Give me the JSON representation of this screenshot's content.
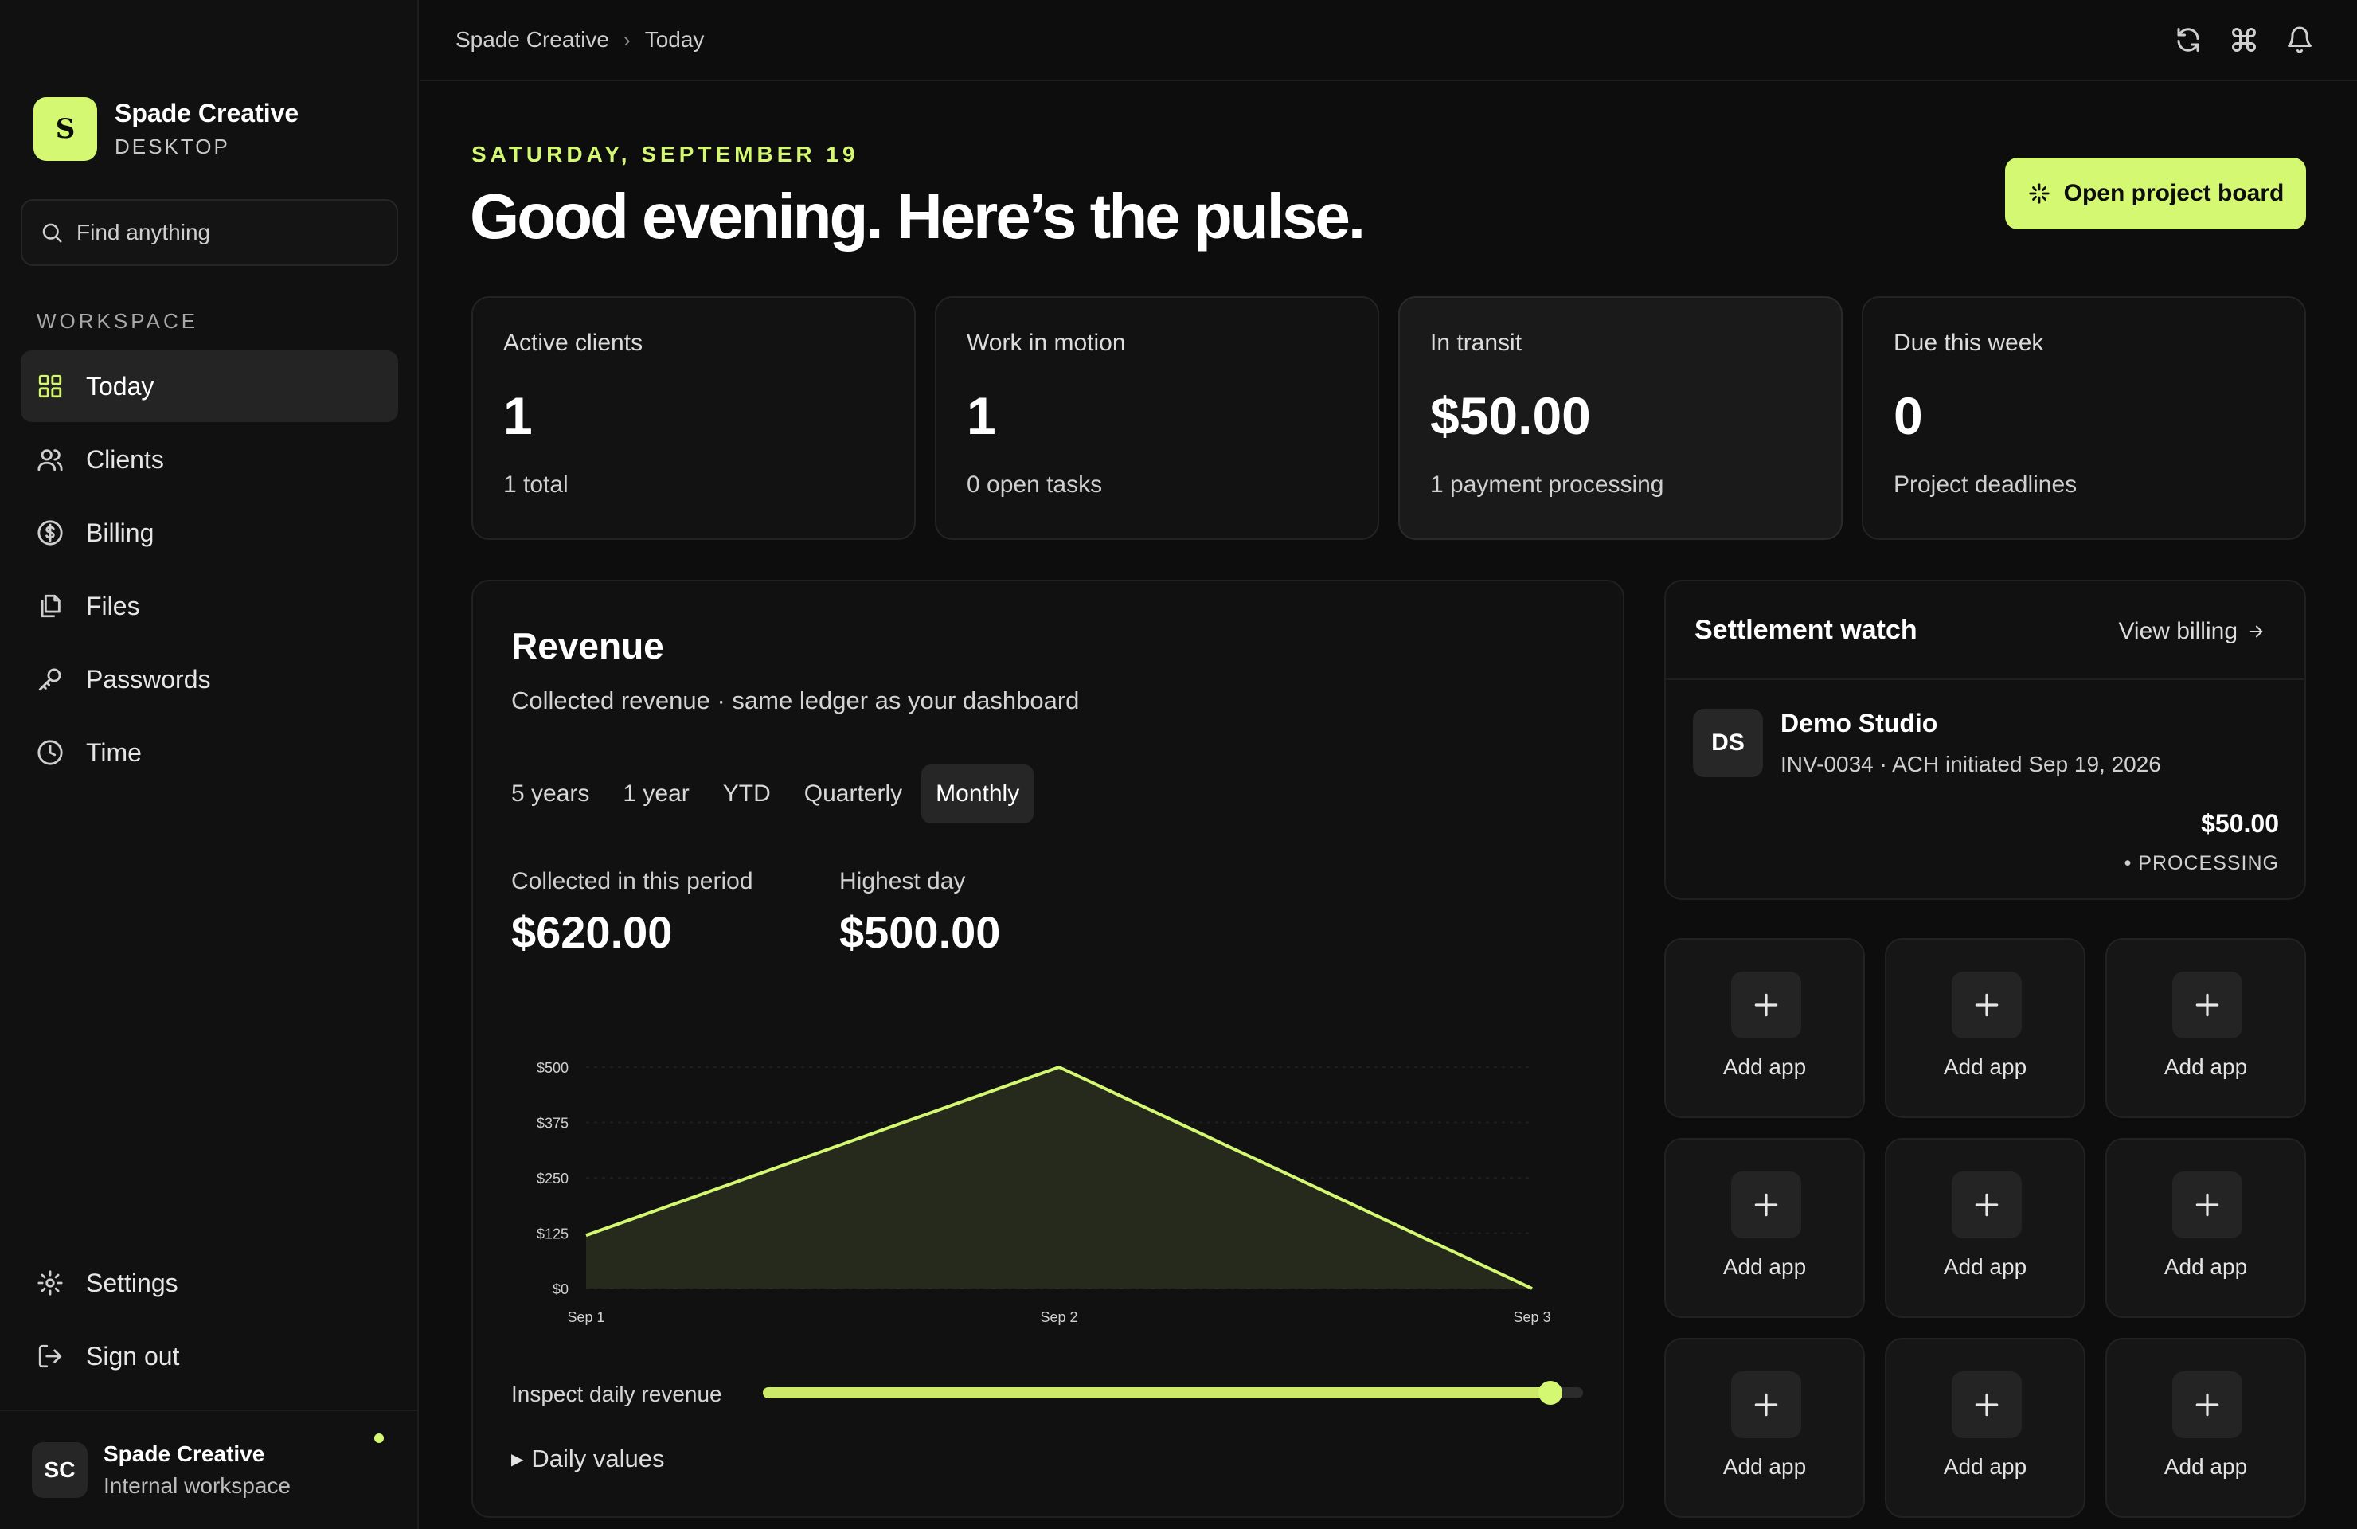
{
  "sidebar": {
    "brand_initial": "S",
    "brand_name": "Spade Creative",
    "brand_sub": "DESKTOP",
    "search_placeholder": "Find anything",
    "section_label": "WORKSPACE",
    "nav": [
      {
        "label": "Today",
        "icon": "grid-icon",
        "active": true
      },
      {
        "label": "Clients",
        "icon": "users-icon"
      },
      {
        "label": "Billing",
        "icon": "dollar-circle-icon"
      },
      {
        "label": "Files",
        "icon": "files-icon"
      },
      {
        "label": "Passwords",
        "icon": "key-icon"
      },
      {
        "label": "Time",
        "icon": "clock-icon"
      }
    ],
    "bottom_nav": [
      {
        "label": "Settings",
        "icon": "gear-icon"
      },
      {
        "label": "Sign out",
        "icon": "sign-out-icon"
      }
    ],
    "profile": {
      "initials": "SC",
      "name": "Spade Creative",
      "sub": "Internal workspace"
    }
  },
  "topbar": {
    "breadcrumb": [
      "Spade Creative",
      "Today"
    ],
    "icons": [
      "refresh-icon",
      "command-icon",
      "bell-icon"
    ]
  },
  "header": {
    "date": "SATURDAY, SEPTEMBER 19",
    "headline": "Good evening. Here’s the pulse.",
    "cta_label": "Open project board"
  },
  "stats": [
    {
      "label": "Active clients",
      "value": "1",
      "sub": "1 total"
    },
    {
      "label": "Work in motion",
      "value": "1",
      "sub": "0 open tasks"
    },
    {
      "label": "In transit",
      "value": "$50.00",
      "sub": "1 payment processing"
    },
    {
      "label": "Due this week",
      "value": "0",
      "sub": "Project deadlines"
    }
  ],
  "revenue": {
    "title": "Revenue",
    "subtitle": "Collected revenue · same ledger as your dashboard",
    "tabs": [
      "5 years",
      "1 year",
      "YTD",
      "Quarterly",
      "Monthly"
    ],
    "active_tab": "Monthly",
    "collected_label": "Collected in this period",
    "collected_value": "$620.00",
    "highest_label": "Highest day",
    "highest_value": "$500.00",
    "slider_label": "Inspect daily revenue",
    "slider_value": 0.96,
    "daily_toggle": "Daily values"
  },
  "chart_data": {
    "type": "area",
    "categories": [
      "Sep 1",
      "Sep 2",
      "Sep 3"
    ],
    "values": [
      120,
      500,
      0
    ],
    "yticks": [
      "$0",
      "$125",
      "$250",
      "$375",
      "$500"
    ],
    "ytick_values": [
      0,
      125,
      250,
      375,
      500
    ],
    "ylim": [
      0,
      500
    ],
    "line_color": "#d4f871",
    "fill_color": "#262a1c"
  },
  "settlement": {
    "title": "Settlement watch",
    "link": "View billing",
    "client_initials": "DS",
    "client_name": "Demo Studio",
    "meta": "INV-0034 · ACH initiated Sep 19, 2026",
    "amount": "$50.00",
    "status": "• PROCESSING"
  },
  "apps": {
    "label": "Add app",
    "count": 9
  },
  "colors": {
    "accent": "#d4f871",
    "background": "#0d0d0d",
    "card": "#111111"
  }
}
